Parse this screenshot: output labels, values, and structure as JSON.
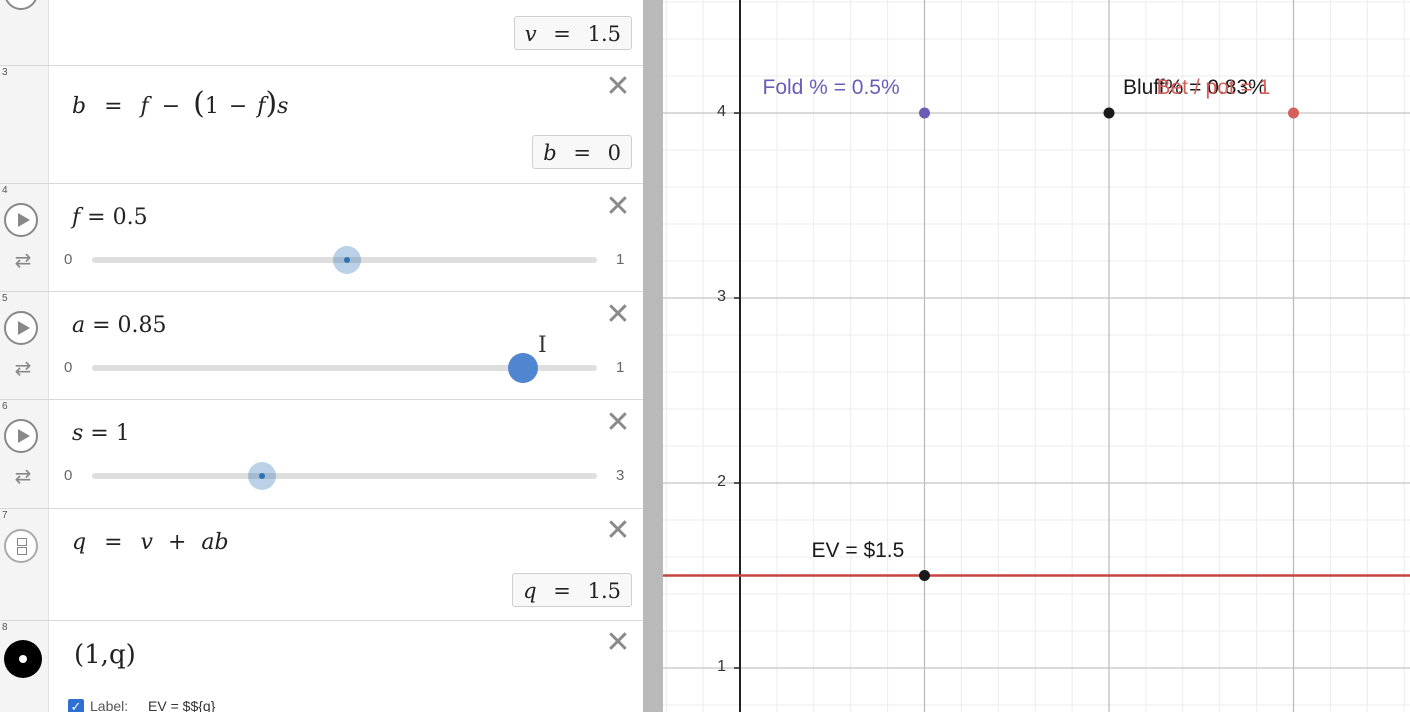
{
  "expressions": {
    "e2": {
      "eval_var": "v",
      "eval_eq": "=",
      "eval_val": "1.5"
    },
    "e3": {
      "number": "3",
      "lhs": "b",
      "rhs_a": "f",
      "minus1": "−",
      "open": "(",
      "one": "1",
      "minus2": "−",
      "f2": "f",
      "close": ")",
      "s": "s",
      "eval_var": "b",
      "eval_eq": "=",
      "eval_val": "0"
    },
    "e4": {
      "number": "4",
      "var": "f",
      "eq": " = ",
      "val": "0.5",
      "min": "0",
      "max": "1",
      "fraction": 0.5
    },
    "e5": {
      "number": "5",
      "var": "a",
      "eq": " = ",
      "val": "0.85",
      "min": "0",
      "max": "1",
      "fraction": 0.85
    },
    "e6": {
      "number": "6",
      "var": "s",
      "eq": " = ",
      "val": "1",
      "min": "0",
      "max": "3",
      "fraction": 0.333
    },
    "e7": {
      "number": "7",
      "lhs": "q",
      "eq": "=",
      "v": "v",
      "plus": "+",
      "ab": "ab",
      "eval_var": "q",
      "eval_eq": "=",
      "eval_val": "1.5"
    },
    "e8": {
      "number": "8",
      "text": "(1,q)",
      "label_caption": "Label:",
      "label_value": "EV = $${q}"
    }
  },
  "close_glyph": "✕",
  "loop_glyph": "⇄",
  "cursor_glyph": "I",
  "graph": {
    "y_ticks": [
      "4",
      "3",
      "2",
      "1"
    ],
    "colors": {
      "purple": "#6b5db5",
      "black": "#1a1a1a",
      "red": "#d3605a",
      "line": "#c74440"
    },
    "points": [
      {
        "label": "Fold % = 0.5%",
        "x": 1,
        "y": 4,
        "color": "#6b5db5"
      },
      {
        "label": "Bluff% = 0.83%",
        "x": 2,
        "y": 4,
        "color": "#1a1a1a"
      },
      {
        "label": "Bet / pot = 1",
        "x": 3,
        "y": 4,
        "color": "#d3605a"
      },
      {
        "label": "EV = $1.5",
        "x": 1,
        "y": 1.5,
        "color": "#1a1a1a"
      }
    ],
    "line_y": 1.5
  }
}
